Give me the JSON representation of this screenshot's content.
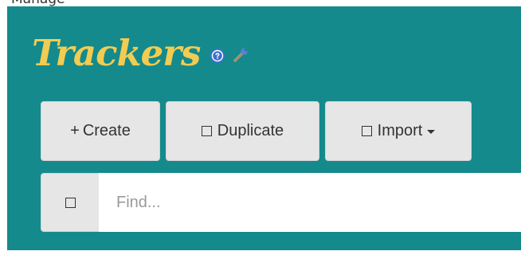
{
  "page": {
    "clipped_heading_text": "Manage"
  },
  "header": {
    "title": "Trackers",
    "help_icon": "question-circle-icon",
    "settings_icon": "wrench-icon",
    "title_color": "#f2cc52",
    "panel_color": "#148a8c"
  },
  "toolbar": {
    "create_prefix": "+",
    "create_label": "Create",
    "duplicate_label": "Duplicate",
    "duplicate_icon": "square-icon",
    "import_label": "Import",
    "import_icon": "square-icon",
    "import_caret_icon": "caret-down-icon"
  },
  "search": {
    "placeholder": "Find...",
    "value": "",
    "addon_icon": "square-icon"
  }
}
